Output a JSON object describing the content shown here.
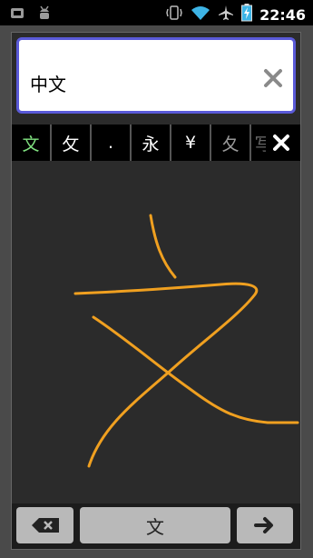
{
  "status_bar": {
    "time": "22:46",
    "icons": [
      "android-icon",
      "android-debug-icon",
      "vibrate-icon",
      "wifi-icon",
      "airplane-icon",
      "battery-charging-icon"
    ]
  },
  "input": {
    "value": "中文"
  },
  "candidates": [
    "文",
    "攵",
    ".",
    "永",
    "¥",
    "夂",
    "写"
  ],
  "keyboard": {
    "space_label": "文"
  },
  "colors": {
    "accent_border": "#5a5ad8",
    "stroke": "#f0a020",
    "active_candidate": "#7fe07f"
  }
}
